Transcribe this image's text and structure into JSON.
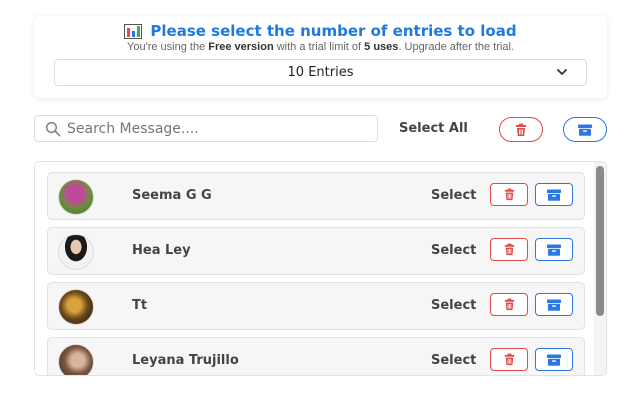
{
  "header": {
    "title": "Please select the number of entries to load",
    "subtitle_parts": {
      "pre": "You're using the ",
      "plan": "Free version",
      "mid": " with a trial limit of ",
      "limit": "5 uses",
      "post": ". Upgrade after the trial."
    },
    "entries_select": {
      "value": "10 Entries",
      "icon": "chevron-down-icon"
    }
  },
  "toolbar": {
    "search_placeholder": "Search Message....",
    "search_value": "",
    "select_all_label": "Select All"
  },
  "contacts": [
    {
      "name": "Seema G G",
      "select_label": "Select"
    },
    {
      "name": "Hea Ley",
      "select_label": "Select"
    },
    {
      "name": "Tt",
      "select_label": "Select"
    },
    {
      "name": "Leyana Trujillo",
      "select_label": "Select"
    }
  ],
  "colors": {
    "accent_blue": "#1f7ae0",
    "delete_red": "#e04a4a",
    "archive_blue": "#2b78e4"
  }
}
